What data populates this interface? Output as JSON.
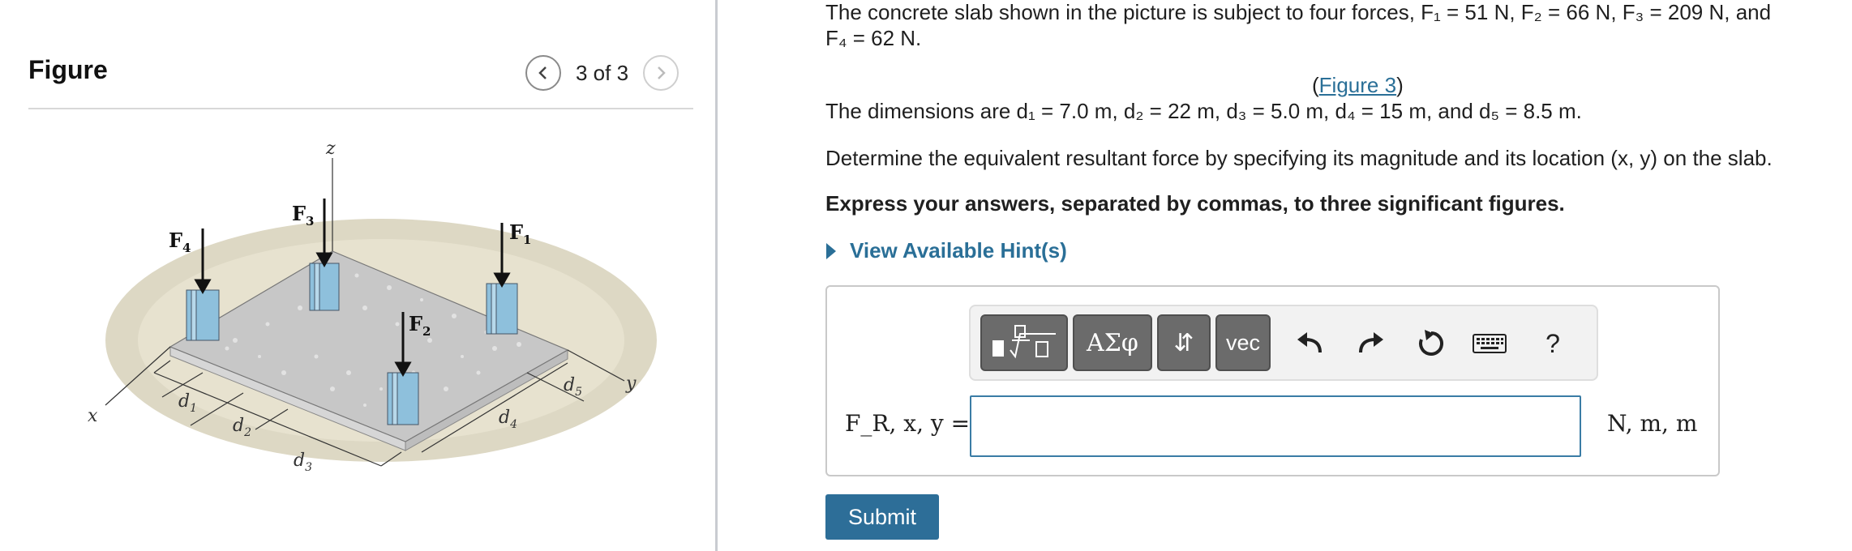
{
  "figure_panel": {
    "heading": "Figure",
    "counter": "3 of 3",
    "diagram_labels": {
      "z": "z",
      "x": "x",
      "y": "y",
      "F1": "F",
      "F1_sub": "1",
      "F2": "F",
      "F2_sub": "2",
      "F3": "F",
      "F3_sub": "3",
      "F4": "F",
      "F4_sub": "4",
      "d1": "d",
      "d1_sub": "1",
      "d2": "d",
      "d2_sub": "2",
      "d3": "d",
      "d3_sub": "3",
      "d4": "d",
      "d4_sub": "4",
      "d5": "d",
      "d5_sub": "5"
    }
  },
  "problem": {
    "intro_1": "The concrete slab shown in the picture is subject to four forces, F₁ = 51 N, F₂ = 66 N, F₃ = 209 N, and",
    "intro_2": "F₄ = 62 N.",
    "figure_link_open": "(",
    "figure_link": "Figure 3",
    "figure_link_close": ")",
    "dimensions": "The dimensions are d₁ = 7.0 m, d₂ = 22 m, d₃ = 5.0 m, d₄ = 15 m, and d₅ = 8.5 m.",
    "question": "Determine the equivalent resultant force by specifying its magnitude and its location (x, y) on the slab.",
    "instruction": "Express your answers, separated by commas, to three significant figures.",
    "hints_label": "View Available Hint(s)"
  },
  "answer": {
    "toolbar": {
      "templates_icon": "fraction-sqrt-icon",
      "greek_label": "ΑΣφ",
      "arrows_label": "⇵",
      "vec_label": "vec",
      "undo_icon": "undo-icon",
      "redo_icon": "redo-icon",
      "reset_icon": "reset-icon",
      "keyboard_icon": "keyboard-icon",
      "help_label": "?"
    },
    "label": "F_R, x, y =",
    "input_value": "",
    "units": "N, m, m",
    "submit_label": "Submit"
  },
  "colors": {
    "accent": "#2d6e98",
    "link": "#2a6f97",
    "toolbar_button": "#6b6b6b",
    "column_blue": "#8ec0dc"
  }
}
